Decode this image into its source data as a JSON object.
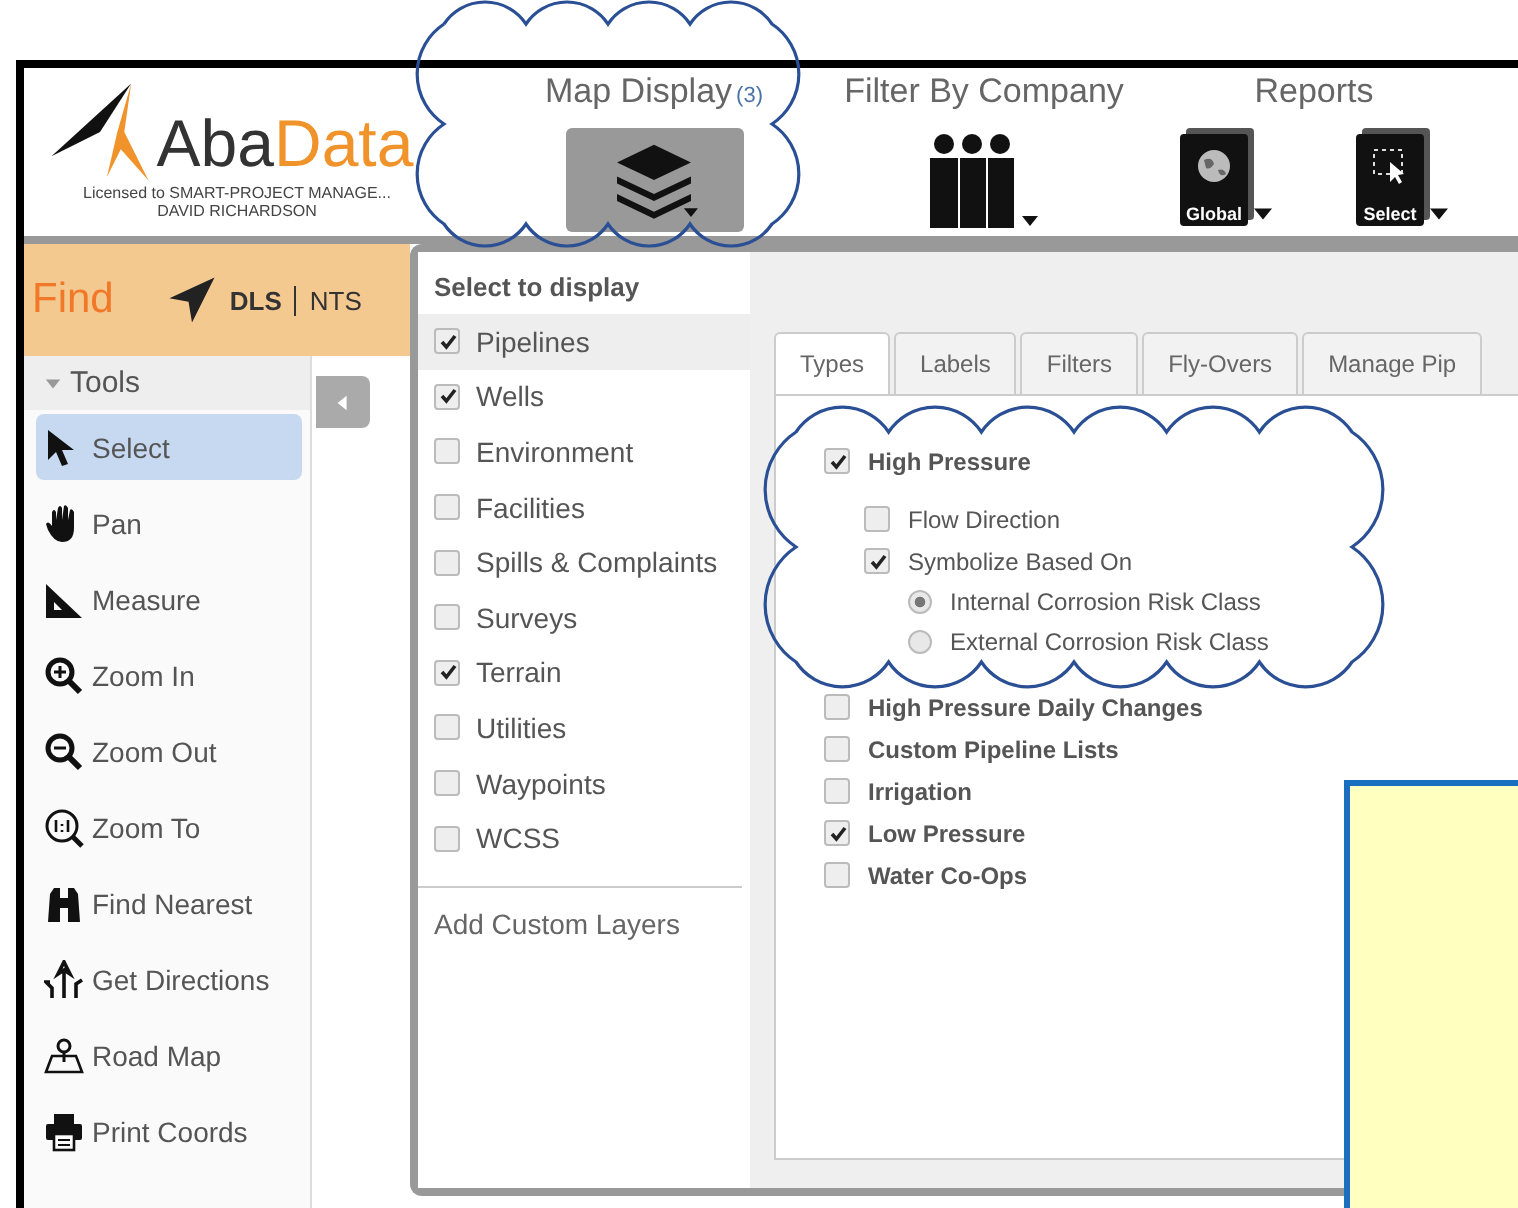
{
  "header": {
    "logo": {
      "name_first": "Aba",
      "name_second": "Data",
      "license": "Licensed to SMART-PROJECT MANAGE...",
      "user": "DAVID RICHARDSON"
    },
    "nav": [
      {
        "label": "Map Display",
        "count": "(3)",
        "tools": [
          {
            "kind": "layers",
            "selected": true
          }
        ]
      },
      {
        "label": "Filter By Company",
        "tools": [
          {
            "kind": "people",
            "selected": false
          }
        ]
      },
      {
        "label": "Reports",
        "tools": [
          {
            "kind": "globe",
            "label": "Global",
            "selected": false
          },
          {
            "kind": "select",
            "label": "Select",
            "selected": false
          }
        ]
      }
    ]
  },
  "find": {
    "label": "Find",
    "modes": [
      {
        "label": "DLS",
        "selected": true
      },
      {
        "label": "NTS",
        "selected": false
      }
    ]
  },
  "tools": {
    "title": "Tools",
    "expanded": true,
    "items": [
      {
        "kind": "select",
        "label": "Select",
        "selected": true
      },
      {
        "kind": "pan",
        "label": "Pan",
        "selected": false
      },
      {
        "kind": "measure",
        "label": "Measure",
        "selected": false
      },
      {
        "kind": "zoomin",
        "label": "Zoom In",
        "selected": false
      },
      {
        "kind": "zoomout",
        "label": "Zoom Out",
        "selected": false
      },
      {
        "kind": "zoomto",
        "label": "Zoom To",
        "selected": false
      },
      {
        "kind": "binoculars",
        "label": "Find Nearest",
        "selected": false
      },
      {
        "kind": "directions",
        "label": "Get Directions",
        "selected": false
      },
      {
        "kind": "map",
        "label": "Road Map",
        "selected": false
      },
      {
        "kind": "printer",
        "label": "Print Coords",
        "selected": false
      }
    ]
  },
  "layers": {
    "title": "Select to display",
    "items": [
      {
        "label": "Pipelines",
        "checked": true,
        "selected": true
      },
      {
        "label": "Wells",
        "checked": true,
        "selected": false
      },
      {
        "label": "Environment",
        "checked": false,
        "selected": false
      },
      {
        "label": "Facilities",
        "checked": false,
        "selected": false
      },
      {
        "label": "Spills & Complaints",
        "checked": false,
        "selected": false
      },
      {
        "label": "Surveys",
        "checked": false,
        "selected": false
      },
      {
        "label": "Terrain",
        "checked": true,
        "selected": false
      },
      {
        "label": "Utilities",
        "checked": false,
        "selected": false
      },
      {
        "label": "Waypoints",
        "checked": false,
        "selected": false
      },
      {
        "label": "WCSS",
        "checked": false,
        "selected": false
      }
    ],
    "add_custom": "Add Custom Layers"
  },
  "tabs": [
    {
      "label": "Types",
      "selected": true
    },
    {
      "label": "Labels",
      "selected": false
    },
    {
      "label": "Filters",
      "selected": false
    },
    {
      "label": "Fly-Overs",
      "selected": false
    },
    {
      "label": "Manage Pip",
      "selected": false
    }
  ],
  "types": [
    {
      "kind": "checkbox",
      "label": "High Pressure",
      "checked": true,
      "children": [
        {
          "kind": "checkbox",
          "label": "Flow Direction",
          "checked": false
        },
        {
          "kind": "checkbox",
          "label": "Symbolize Based On",
          "checked": true,
          "children": [
            {
              "kind": "radio",
              "label": "Internal Corrosion Risk Class",
              "selected": true
            },
            {
              "kind": "radio",
              "label": "External Corrosion Risk Class",
              "selected": false
            }
          ]
        }
      ]
    },
    {
      "kind": "checkbox",
      "label": "High Pressure Daily Changes",
      "checked": false
    },
    {
      "kind": "checkbox",
      "label": "Custom Pipeline Lists",
      "checked": false
    },
    {
      "kind": "checkbox",
      "label": "Irrigation",
      "checked": false
    },
    {
      "kind": "checkbox",
      "label": "Low Pressure",
      "checked": true
    },
    {
      "kind": "checkbox",
      "label": "Water Co-Ops",
      "checked": false
    }
  ]
}
